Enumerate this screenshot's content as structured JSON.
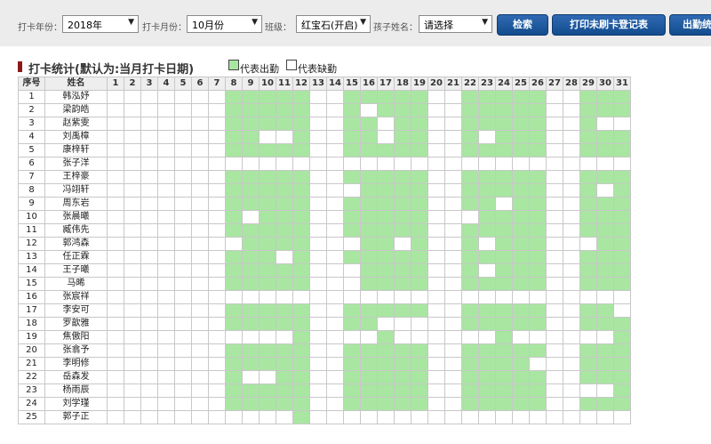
{
  "filters": {
    "year_label": "打卡年份：",
    "year_value": "2018年",
    "month_label": "打卡月份：",
    "month_value": "10月份",
    "class_label": "班级：",
    "class_value": "红宝石(开启)",
    "child_label": "孩子姓名：",
    "child_value": "请选择"
  },
  "buttons": {
    "search": "检索",
    "print": "打印未刷卡登记表",
    "attendance": "出勤统"
  },
  "section": {
    "title": "打卡统计(默认为:当月打卡日期)",
    "legend_present": "代表出勤",
    "legend_absent": "代表缺勤"
  },
  "colors": {
    "present": "#a8e6a1",
    "absent": "#ffffff",
    "button": "#1f5a9e"
  },
  "table": {
    "col_index": "序号",
    "col_name": "姓名",
    "days": [
      "1",
      "2",
      "3",
      "4",
      "5",
      "6",
      "7",
      "8",
      "9",
      "10",
      "11",
      "12",
      "13",
      "14",
      "15",
      "16",
      "17",
      "18",
      "19",
      "20",
      "21",
      "22",
      "23",
      "24",
      "25",
      "26",
      "27",
      "28",
      "29",
      "30",
      "31"
    ],
    "rows": [
      {
        "n": "1",
        "name": "韩泓妤",
        "att": "0000000111110011111001111100111"
      },
      {
        "n": "2",
        "name": "梁韵皓",
        "att": "0000000111110010111001111100111"
      },
      {
        "n": "3",
        "name": "赵紫雯",
        "att": "0000000111110011011001111100100"
      },
      {
        "n": "4",
        "name": "刘禹樟",
        "att": "0000000110010011011001011100111"
      },
      {
        "n": "5",
        "name": "康梓轩",
        "att": "0000000111110011111001111100111"
      },
      {
        "n": "6",
        "name": "张子洋",
        "att": "0000000000000000000000000000000"
      },
      {
        "n": "7",
        "name": "王梓豪",
        "att": "0000000111110011111001111100111"
      },
      {
        "n": "8",
        "name": "冯翊轩",
        "att": "0000000111110001111001111100101"
      },
      {
        "n": "9",
        "name": "周东岩",
        "att": "0000000111110011111001101100111"
      },
      {
        "n": "10",
        "name": "张晨曦",
        "att": "0000000101110011111000111100111"
      },
      {
        "n": "11",
        "name": "臧伟先",
        "att": "0000000111110011111001111100111"
      },
      {
        "n": "12",
        "name": "郭鸿森",
        "att": "0000000011110001101001011100011"
      },
      {
        "n": "13",
        "name": "任正霖",
        "att": "0000000111010011111001111100111"
      },
      {
        "n": "14",
        "name": "王子曦",
        "att": "0000000111110001111001011100111"
      },
      {
        "n": "15",
        "name": "马晞",
        "att": "0000000111110001111001111100111"
      },
      {
        "n": "16",
        "name": "张宸祥",
        "att": "0000000000000000000000000000000"
      },
      {
        "n": "17",
        "name": "李安可",
        "att": "0000000111110011111001111100110"
      },
      {
        "n": "18",
        "name": "罗歆雅",
        "att": "0000000111110011000001111100111"
      },
      {
        "n": "19",
        "name": "焦傲阳",
        "att": "0000000000010000100000010000001"
      },
      {
        "n": "20",
        "name": "张翕予",
        "att": "0000000111110011111001111100111"
      },
      {
        "n": "21",
        "name": "李明修",
        "att": "0000000111110011111001111000111"
      },
      {
        "n": "22",
        "name": "岳森发",
        "att": "0000000100110011111001111100111"
      },
      {
        "n": "23",
        "name": "杨雨辰",
        "att": "0000000111110011111001111100001"
      },
      {
        "n": "24",
        "name": "刘学瑾",
        "att": "0000000111110011111001111100111"
      },
      {
        "n": "25",
        "name": "郭子正",
        "att": "0000000000010000000000000000000"
      }
    ]
  }
}
